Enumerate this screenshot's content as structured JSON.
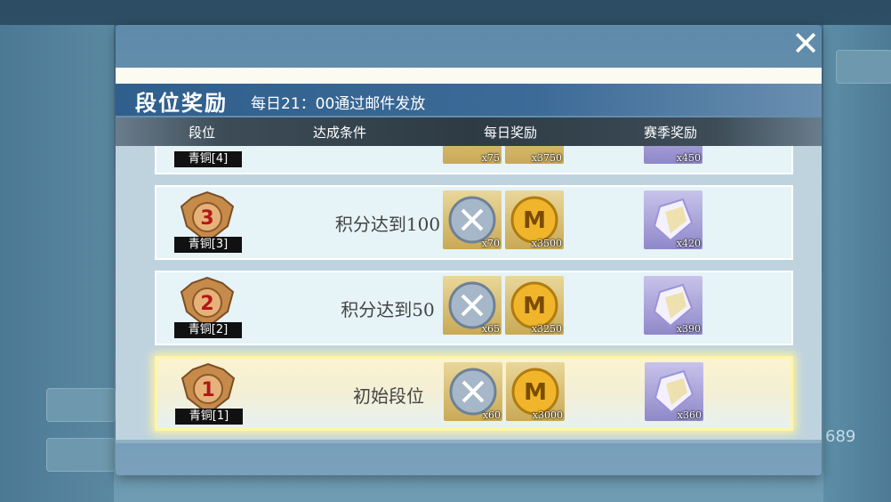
{
  "background": {
    "right_number": "689"
  },
  "modal": {
    "title": "段位奖励",
    "subtitle": "每日21：00通过邮件发放",
    "close_glyph": "✕",
    "columns": [
      "段位",
      "达成条件",
      "每日奖励",
      "赛季奖励"
    ]
  },
  "rows": [
    {
      "rank": "青铜[4]",
      "condition": "",
      "daily": [
        {
          "icon": "sword-coin-icon",
          "qty": "x75"
        },
        {
          "icon": "gold-m-coin-icon",
          "qty": "x3750"
        }
      ],
      "season": {
        "icon": "crystal-icon",
        "qty": "x450"
      },
      "partial": true
    },
    {
      "rank": "青铜[3]",
      "condition": "积分达到100",
      "daily": [
        {
          "icon": "sword-coin-icon",
          "qty": "x70"
        },
        {
          "icon": "gold-m-coin-icon",
          "qty": "x3500"
        }
      ],
      "season": {
        "icon": "crystal-icon",
        "qty": "x420"
      }
    },
    {
      "rank": "青铜[2]",
      "condition": "积分达到50",
      "daily": [
        {
          "icon": "sword-coin-icon",
          "qty": "x65"
        },
        {
          "icon": "gold-m-coin-icon",
          "qty": "x3250"
        }
      ],
      "season": {
        "icon": "crystal-icon",
        "qty": "x390"
      }
    },
    {
      "rank": "青铜[1]",
      "condition": "初始段位",
      "daily": [
        {
          "icon": "sword-coin-icon",
          "qty": "x60"
        },
        {
          "icon": "gold-m-coin-icon",
          "qty": "x3000"
        }
      ],
      "season": {
        "icon": "crystal-icon",
        "qty": "x360"
      },
      "active": true
    }
  ],
  "colors": {
    "title_bar": "#2f5f8c",
    "highlight": "#fff3a0"
  }
}
